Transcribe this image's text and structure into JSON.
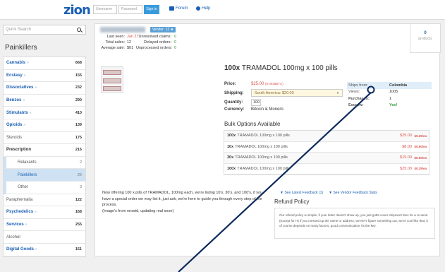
{
  "header": {
    "logo": "zion",
    "username_placeholder": "Username",
    "password_placeholder": "Password",
    "signin_label": "Sign in",
    "forum_label": "Forum",
    "help_label": "Help"
  },
  "sidebar": {
    "search_placeholder": "Quick Search",
    "title": "Painkillers",
    "categories": [
      {
        "label": "Cannabis",
        "count": "668",
        "style": "link",
        "arrow": "»"
      },
      {
        "label": "Ecstasy",
        "count": "155",
        "style": "link",
        "arrow": "»"
      },
      {
        "label": "Dissociatives",
        "count": "232",
        "style": "link",
        "arrow": "»"
      },
      {
        "label": "Benzos",
        "count": "290",
        "style": "link",
        "arrow": "»"
      },
      {
        "label": "Stimulants",
        "count": "410",
        "style": "link",
        "arrow": "»"
      },
      {
        "label": "Opioids",
        "count": "139",
        "style": "link",
        "arrow": "»"
      },
      {
        "label": "Steroids",
        "count": "175",
        "style": "plain",
        "arrow": ""
      },
      {
        "label": "Prescription",
        "count": "216",
        "style": "bold",
        "arrow": ""
      },
      {
        "label": "Relaxants",
        "count": "2",
        "style": "sub",
        "arrow": ""
      },
      {
        "label": "Painkillers",
        "count": "26",
        "style": "active",
        "arrow": ""
      },
      {
        "label": "Other",
        "count": "3",
        "style": "sub",
        "arrow": ""
      },
      {
        "label": "Paraphernalia",
        "count": "122",
        "style": "plain",
        "arrow": ""
      },
      {
        "label": "Psychedelics",
        "count": "168",
        "style": "link",
        "arrow": "»"
      },
      {
        "label": "Services",
        "count": "255",
        "style": "link",
        "arrow": "»"
      },
      {
        "label": "Alcohol",
        "count": "",
        "style": "plain",
        "arrow": ""
      },
      {
        "label": "Digital Goods",
        "count": "151",
        "style": "link",
        "arrow": "»"
      }
    ]
  },
  "vendor": {
    "badge": "Vendor: 12 ★",
    "last_seen_label": "Last seen:",
    "last_seen_value": "Jan 27",
    "total_sales_label": "Total sales:",
    "total_sales_value": "12",
    "average_sale_label": "Average sale:",
    "average_sale_value": "$01",
    "unresolved_label": "Unresolved claims:",
    "unresolved_value": "0",
    "delayed_label": "Delayed orders:",
    "delayed_value": "0",
    "unprocessed_label": "Unprocessed orders:",
    "unprocessed_value": "0"
  },
  "product": {
    "title_qty": "100x",
    "title_name": "TRAMADOL 100mg x 100 pills",
    "price_label": "Price:",
    "price_value": "$25.00",
    "price_btc": "(0.0038BTC)",
    "shipping_label": "Shipping:",
    "shipping_value": "South America: $20.00",
    "quantity_label": "Quantity:",
    "quantity_value": "100",
    "currency_label": "Currency:",
    "currency_value": "Bitcoin & Monero"
  },
  "info": {
    "ships_from_label": "Ships from:",
    "ships_from_value": "Colombia",
    "views_label": "Views:",
    "views_value": "1005",
    "purchases_label": "Purchases:",
    "purchases_value": "1",
    "escrow_label": "Escrow:",
    "escrow_value": "Yes!"
  },
  "bulk": {
    "title": "Bulk Options Available",
    "rows": [
      {
        "qty": "100x",
        "name": "TRAMADOL 100mg x 100 pills",
        "price": "$25.00",
        "each": "$0.25/ea"
      },
      {
        "qty": "10x",
        "name": "TRAMADOL 100mg x 100 pills",
        "price": "$8.00",
        "each": "$0.80/ea"
      },
      {
        "qty": "30x",
        "name": "TRAMADOL 100mg x 100 pills",
        "price": "$15.00",
        "each": "$0.50/ea"
      },
      {
        "qty": "100x",
        "name": "TRAMADOL 100mg x 100 pills",
        "price": "$25.00",
        "each": "$0.25/ea"
      }
    ]
  },
  "description": {
    "line1": "Now offering 100 x pills of TRAMADOL, 100mg each, we're listing 10's, 30's, and 100's, if you have a special order we may list it, just ask, we're here to guide you through every step of the process.",
    "line2": "(Image's from erowid, updating real soon)"
  },
  "feedback": {
    "latest_label": "See Latest Feedback (1)",
    "vendor_label": "See Vendor Feedback Stats",
    "refund_title": "Refund Policy",
    "refund_text": "Our refund policy is simple, if your letter doesn't show up, you just gotta cover shipment fees for a re-send (Except for H) If you messed up the name or address, we MAY figure something out, we're cool like that, it of course depends on many factors, good communication it's the key."
  },
  "cart": {
    "count": "0",
    "label": "products"
  },
  "colors": {
    "accent": "#1a5fb4",
    "price": "#d9534f",
    "annotation_line": "#0d2a5c"
  }
}
